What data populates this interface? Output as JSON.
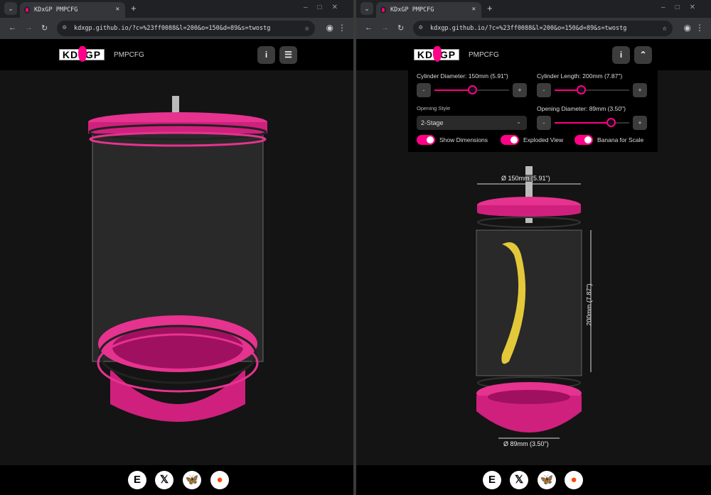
{
  "browser": {
    "tab_title": "KDxGP PMPCFG",
    "url": "kdxgp.github.io/?c=%23ff0088&l=200&o=150&d=89&s=twostg"
  },
  "app": {
    "logo_text": "KD GP",
    "name": "PMPCFG"
  },
  "controls": {
    "cylinder_diameter": {
      "label": "Cylinder Diameter: 150mm (5.91\")",
      "value_mm": 150,
      "fraction": 0.5
    },
    "cylinder_length": {
      "label": "Cylinder Length: 200mm (7.87\")",
      "value_mm": 200,
      "fraction": 0.35
    },
    "opening_style": {
      "label": "Opening Style",
      "value": "2-Stage"
    },
    "opening_diameter": {
      "label": "Opening Diameter: 89mm (3.50\")",
      "value_mm": 89,
      "fraction": 0.75
    },
    "minus": "-",
    "plus": "+",
    "toggles": [
      {
        "label": "Show Dimensions",
        "on": true
      },
      {
        "label": "Exploded View",
        "on": true
      },
      {
        "label": "Banana for Scale",
        "on": true
      }
    ]
  },
  "dimensions": {
    "diameter": "Ø 150mm (5.91\")",
    "length": "200mm (7.87\")",
    "opening": "Ø 89mm (3.50\")"
  },
  "footer": {
    "links": [
      {
        "name": "etsy",
        "glyph": "E"
      },
      {
        "name": "x",
        "glyph": "𝕏"
      },
      {
        "name": "bluesky",
        "glyph": "🦋"
      },
      {
        "name": "reddit",
        "glyph": "●"
      }
    ]
  },
  "colors": {
    "accent": "#ff0088"
  }
}
